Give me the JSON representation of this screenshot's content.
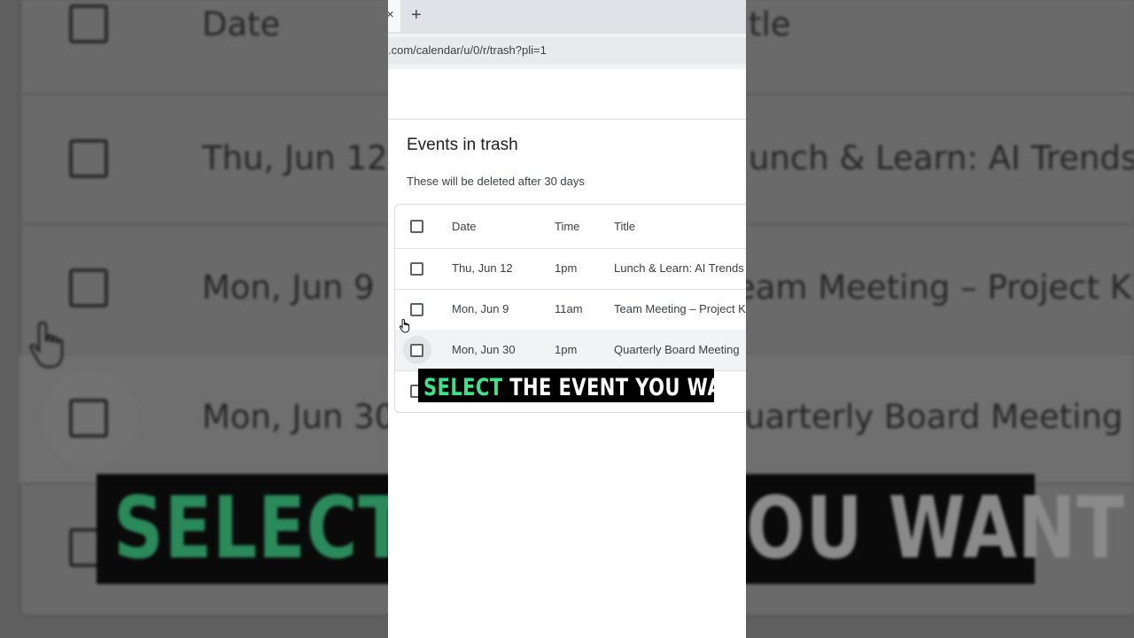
{
  "browser": {
    "close_glyph": "×",
    "new_tab_glyph": "+",
    "url": ".com/calendar/u/0/r/trash?pli=1"
  },
  "page": {
    "title": "Events in trash",
    "subtitle": "These will be deleted after 30 days"
  },
  "table": {
    "headers": {
      "date": "Date",
      "time": "Time",
      "title": "Title"
    },
    "rows": [
      {
        "date": "Thu, Jun 12",
        "time": "1pm",
        "title": "Lunch & Learn: AI Trends in"
      },
      {
        "date": "Mon, Jun 9",
        "time": "11am",
        "title": "Team Meeting – Project Kic"
      },
      {
        "date": "Mon, Jun 30",
        "time": "1pm",
        "title": "Quarterly Board Meeting"
      }
    ]
  },
  "caption": {
    "highlight": "SELECT",
    "rest": " THE EVENT YOU WANT"
  },
  "background": {
    "header_date": "Date",
    "header_title": "tle",
    "rows": [
      {
        "date": "Thu, Jun 12",
        "title": "unch & Learn: AI Trends in"
      },
      {
        "date": "Mon, Jun 9",
        "title": "eam Meeting – Project Kic"
      },
      {
        "date": "Mon, Jun 30",
        "title": "uarterly Board Meeting"
      }
    ],
    "caption_highlight": "SELECT",
    "caption_left_rest": " T",
    "caption_right": "OU WANT"
  },
  "colors": {
    "caption_highlight": "#3ee08a",
    "caption_background": "#000000"
  },
  "icons": [
    "close-icon",
    "plus-icon",
    "hand-cursor-icon",
    "checkbox-icon"
  ]
}
